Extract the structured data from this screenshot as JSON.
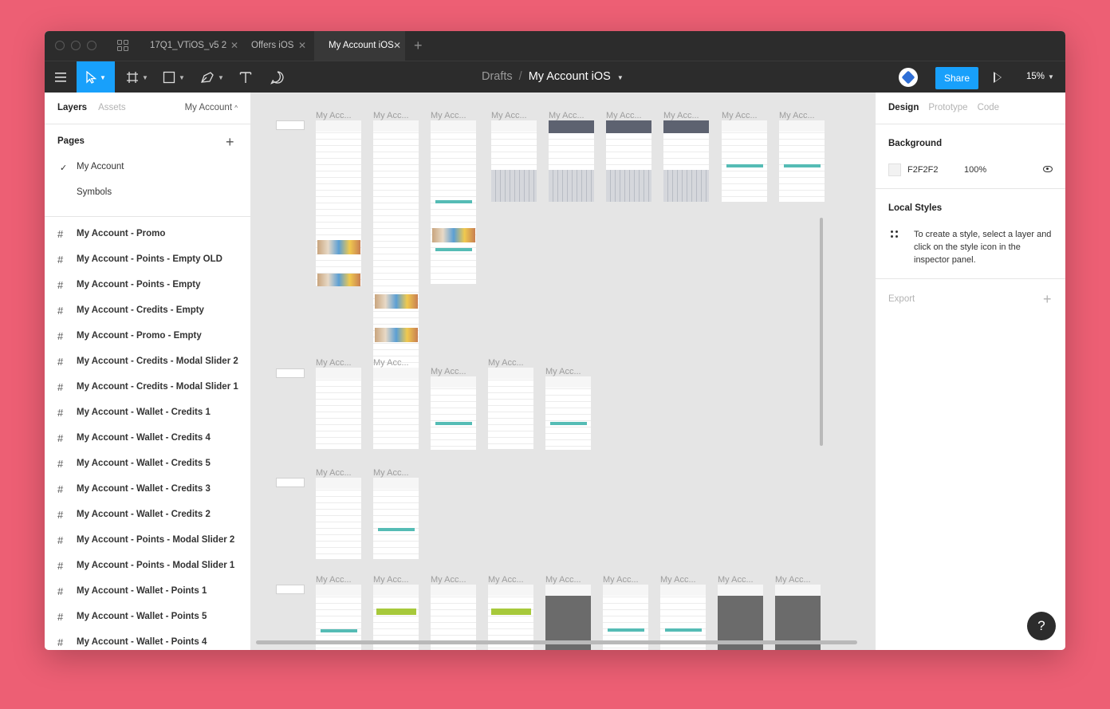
{
  "tabs": {
    "items": [
      "17Q1_VTiOS_v5 2",
      "Offers iOS",
      "My Account iOS"
    ],
    "active": "My Account iOS",
    "close_glyph": "✕",
    "add_glyph": "+"
  },
  "toolbar": {
    "breadcrumb_parent": "Drafts",
    "breadcrumb_separator": "/",
    "breadcrumb_current": "My Account iOS",
    "share_label": "Share",
    "zoom": "15%",
    "accent_color": "#18A0FB"
  },
  "left_panel": {
    "tab_layers": "Layers",
    "tab_assets": "Assets",
    "page_select": "My Account",
    "pages_title": "Pages",
    "pages": [
      "My Account",
      "Symbols"
    ],
    "current_page": "My Account",
    "layers": [
      "My Account - Promo",
      "My Account - Points - Empty OLD",
      "My Account - Points - Empty",
      "My Account - Credits - Empty",
      "My Account - Promo - Empty",
      "My Account - Credits - Modal Slider 2",
      "My Account - Credits - Modal Slider 1",
      "My Account - Wallet - Credits 1",
      "My Account - Wallet - Credits 4",
      "My Account - Wallet - Credits 5",
      "My Account - Wallet - Credits 3",
      "My Account - Wallet - Credits 2",
      "My Account - Points - Modal Slider 2",
      "My Account - Points - Modal Slider 1",
      "My Account - Wallet - Points 1",
      "My Account - Wallet - Points 5",
      "My Account - Wallet - Points 4"
    ]
  },
  "canvas": {
    "frame_title": "My Acc...",
    "background": "#F2F2F2"
  },
  "right_panel": {
    "tab_design": "Design",
    "tab_prototype": "Prototype",
    "tab_code": "Code",
    "background_title": "Background",
    "background_hex": "F2F2F2",
    "background_opacity": "100%",
    "local_styles_title": "Local Styles",
    "local_styles_hint": "To create a style, select a layer and click on the style icon in the inspector panel.",
    "export_title": "Export",
    "export_add": "+"
  },
  "help_label": "?",
  "icons": [
    "grid-icon",
    "menu-icon",
    "move-tool-icon",
    "frame-tool-icon",
    "shape-tool-icon",
    "pen-tool-icon",
    "text-tool-icon",
    "comment-tool-icon",
    "play-icon",
    "eye-icon",
    "style-icon",
    "checkmark-icon",
    "frame-hash-icon"
  ]
}
